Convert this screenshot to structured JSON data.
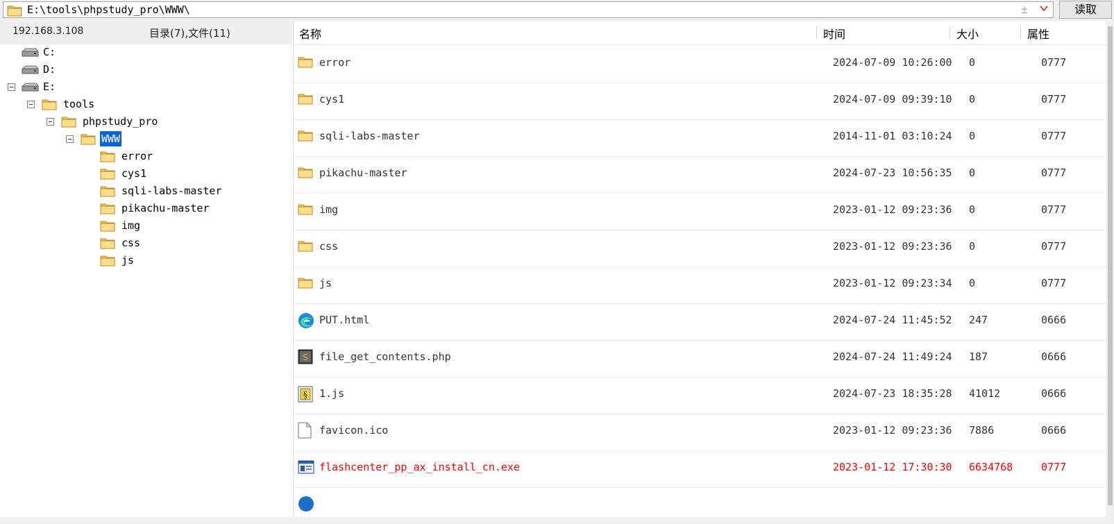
{
  "address": {
    "path": "E:\\tools\\phpstudy_pro\\WWW\\",
    "plus_glyph": "±",
    "read_button": "读取"
  },
  "status": {
    "ip": "192.168.3.108",
    "counts": "目录(7),文件(11)"
  },
  "tree": [
    {
      "label": "C:",
      "icon": "drive-icon"
    },
    {
      "label": "D:",
      "icon": "drive-icon"
    },
    {
      "label": "E:",
      "icon": "drive-icon"
    },
    {
      "label": "tools",
      "icon": "folder-icon"
    },
    {
      "label": "phpstudy_pro",
      "icon": "folder-icon"
    },
    {
      "label": "WWW",
      "icon": "open-folder-icon",
      "selected": true
    },
    {
      "label": "error",
      "icon": "folder-icon"
    },
    {
      "label": "cys1",
      "icon": "folder-icon"
    },
    {
      "label": "sqli-labs-master",
      "icon": "folder-icon"
    },
    {
      "label": "pikachu-master",
      "icon": "folder-icon"
    },
    {
      "label": "img",
      "icon": "folder-icon"
    },
    {
      "label": "css",
      "icon": "folder-icon"
    },
    {
      "label": "js",
      "icon": "folder-icon"
    }
  ],
  "columns": {
    "name": "名称",
    "time": "时间",
    "size": "大小",
    "attr": "属性"
  },
  "files": [
    {
      "name": "error",
      "time": "2024-07-09 10:26:00",
      "size": "0",
      "attr": "0777",
      "icon": "folder-icon"
    },
    {
      "name": "cys1",
      "time": "2024-07-09 09:39:10",
      "size": "0",
      "attr": "0777",
      "icon": "folder-icon"
    },
    {
      "name": "sqli-labs-master",
      "time": "2014-11-01 03:10:24",
      "size": "0",
      "attr": "0777",
      "icon": "folder-icon"
    },
    {
      "name": "pikachu-master",
      "time": "2024-07-23 10:56:35",
      "size": "0",
      "attr": "0777",
      "icon": "folder-icon"
    },
    {
      "name": "img",
      "time": "2023-01-12 09:23:36",
      "size": "0",
      "attr": "0777",
      "icon": "folder-icon"
    },
    {
      "name": "css",
      "time": "2023-01-12 09:23:36",
      "size": "0",
      "attr": "0777",
      "icon": "folder-icon"
    },
    {
      "name": "js",
      "time": "2023-01-12 09:23:34",
      "size": "0",
      "attr": "0777",
      "icon": "folder-icon"
    },
    {
      "name": "PUT.html",
      "time": "2024-07-24 11:45:52",
      "size": "247",
      "attr": "0666",
      "icon": "edge-html-icon"
    },
    {
      "name": "file_get_contents.php",
      "time": "2024-07-24 11:49:24",
      "size": "187",
      "attr": "0666",
      "icon": "php-file-icon"
    },
    {
      "name": "1.js",
      "time": "2024-07-23 18:35:28",
      "size": "41012",
      "attr": "0666",
      "icon": "js-file-icon"
    },
    {
      "name": "favicon.ico",
      "time": "2023-01-12 09:23:36",
      "size": "7886",
      "attr": "0666",
      "icon": "blank-file-icon"
    },
    {
      "name": "flashcenter_pp_ax_install_cn.exe",
      "time": "2023-01-12 17:30:30",
      "size": "6634768",
      "attr": "0777",
      "icon": "exe-file-icon",
      "highlight": "red"
    }
  ],
  "colors": {
    "selection": "#0a64d7",
    "highlight_red": "#ff0000",
    "folder_yellow": "#f5c542"
  }
}
